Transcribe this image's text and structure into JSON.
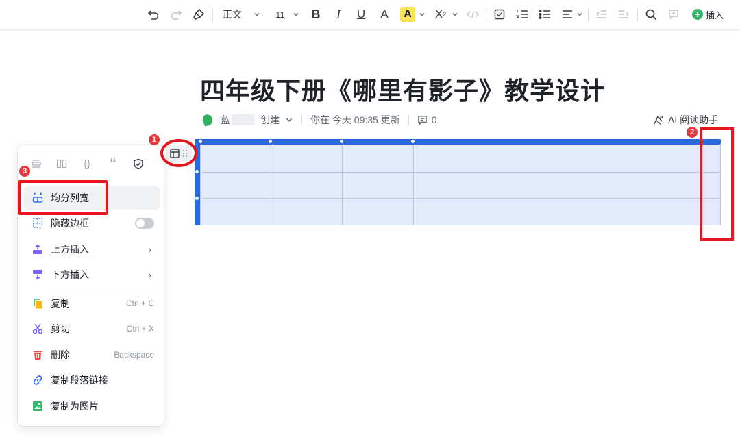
{
  "toolbar": {
    "style": "正文",
    "font_size": "11",
    "insert_label": "插入",
    "icons": [
      "undo-icon",
      "redo-icon",
      "format-painter-icon",
      "bold-icon",
      "italic-icon",
      "underline-icon",
      "strikethrough-icon",
      "highlight-icon",
      "superscript-icon",
      "code-icon",
      "checkbox-icon",
      "ordered-list-icon",
      "bullet-list-icon",
      "align-icon",
      "outdent-icon",
      "indent-icon",
      "search-icon",
      "comment-icon",
      "plus-icon"
    ]
  },
  "document": {
    "title": "四年级下册《哪里有影子》教学设计",
    "meta": {
      "author": "蓝",
      "created": "创建",
      "updated": "你在 今天 09:35 更新",
      "comments": "0"
    },
    "ai_helper": "AI 阅读助手"
  },
  "annotations": [
    "1",
    "2",
    "3"
  ],
  "context_menu": {
    "top_icons": [
      "insert-block-icon",
      "columns-icon",
      "code-block-icon",
      "quote-icon",
      "shield-icon"
    ],
    "items": [
      {
        "label": "均分列宽",
        "icon": "distribute-columns-icon"
      },
      {
        "label": "隐藏边框",
        "icon": "hide-border-icon",
        "toggle": false
      },
      {
        "label": "上方插入",
        "icon": "insert-above-icon",
        "submenu": true
      },
      {
        "label": "下方插入",
        "icon": "insert-below-icon",
        "submenu": true
      },
      {
        "label": "复制",
        "icon": "copy-icon",
        "shortcut": "Ctrl + C"
      },
      {
        "label": "剪切",
        "icon": "cut-icon",
        "shortcut": "Ctrl + X"
      },
      {
        "label": "删除",
        "icon": "delete-icon",
        "shortcut": "Backspace"
      },
      {
        "label": "复制段落链接",
        "icon": "link-icon"
      },
      {
        "label": "复制为图片",
        "icon": "image-icon"
      }
    ]
  },
  "colors": {
    "accent_blue": "#2a6ae0",
    "table_fill": "#e2eafb",
    "annotation_red": "#e5161d"
  }
}
